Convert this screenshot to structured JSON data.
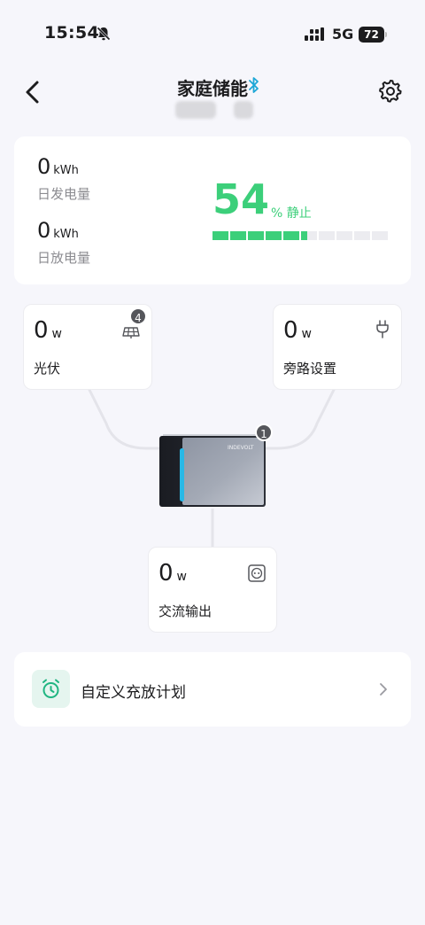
{
  "status_bar": {
    "time": "15:54",
    "network": "5G",
    "battery": "72"
  },
  "header": {
    "title": "家庭储能"
  },
  "energy": {
    "generated_value": "0",
    "generated_unit": "kWh",
    "generated_label": "日发电量",
    "discharged_value": "0",
    "discharged_unit": "kWh",
    "discharged_label": "日放电量",
    "soc_value": "54",
    "soc_unit_status": "% 静止",
    "soc_fraction": 0.54,
    "accent_color": "#3ccf7a"
  },
  "flow": {
    "pv": {
      "value": "0",
      "unit": "w",
      "label": "光伏",
      "badge": "4",
      "icon": "solar-panel-icon"
    },
    "bypass": {
      "value": "0",
      "unit": "w",
      "label": "旁路设置",
      "icon": "plug-icon"
    },
    "device": {
      "badge": "1",
      "brand": "INDEVOLT"
    },
    "ac_output": {
      "value": "0",
      "unit": "w",
      "label": "交流输出",
      "icon": "socket-icon"
    }
  },
  "schedule": {
    "label": "自定义充放计划",
    "icon": "alarm-clock-icon"
  }
}
